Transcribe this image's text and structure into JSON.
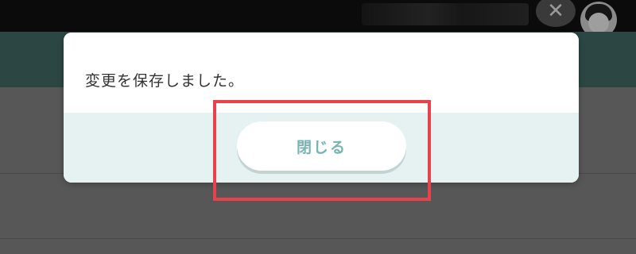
{
  "dialog": {
    "message": "変更を保存しました。",
    "close_button_label": "閉じる"
  },
  "background": {
    "close_glyph": "✕"
  },
  "icons": {
    "close": "close-icon",
    "avatar": "avatar-icon"
  },
  "colors": {
    "highlight": "#e8434d",
    "button_text": "#79b3b3",
    "footer_bg": "#e6f2f1"
  }
}
